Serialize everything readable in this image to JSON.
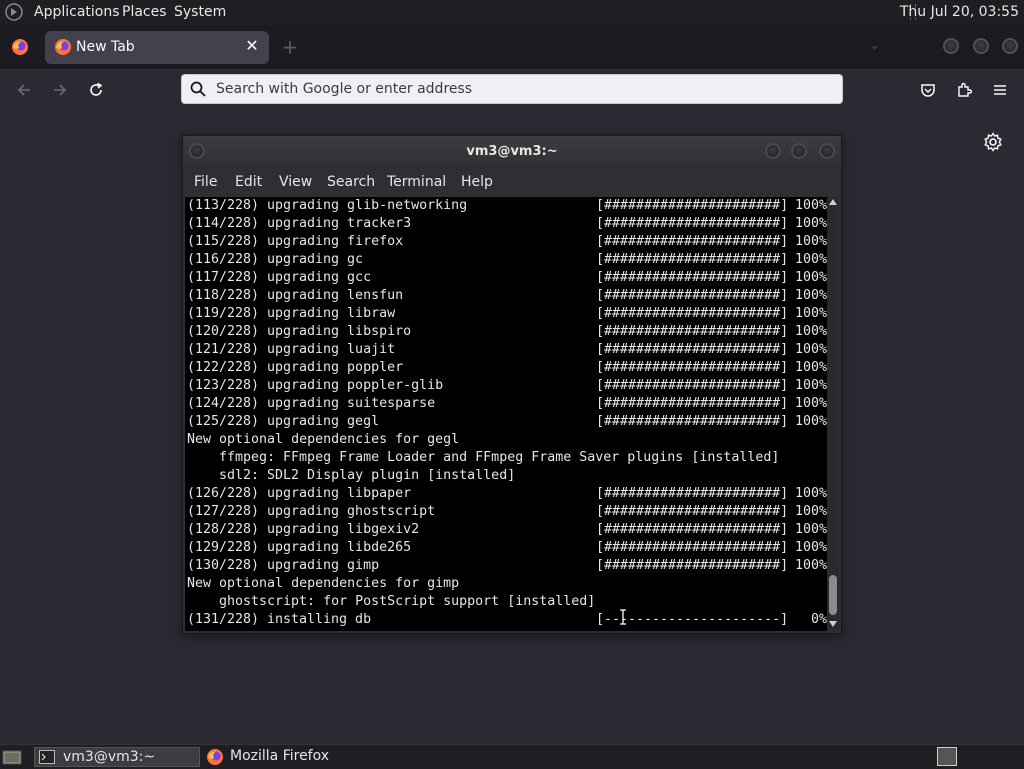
{
  "top_panel": {
    "menus": [
      "Applications",
      "Places",
      "System"
    ],
    "clock": "Thu Jul 20, 03:55"
  },
  "browser": {
    "tab_title": "New Tab",
    "url_placeholder": "Search with Google or enter address"
  },
  "terminal": {
    "title": "vm3@vm3:~",
    "menu": [
      "File",
      "Edit",
      "View",
      "Search",
      "Terminal",
      "Help"
    ],
    "lines": [
      {
        "kind": "progress",
        "num": "(113/228)",
        "text": "upgrading glib-networking",
        "bar": "[######################]",
        "pct": "100%"
      },
      {
        "kind": "progress",
        "num": "(114/228)",
        "text": "upgrading tracker3",
        "bar": "[######################]",
        "pct": "100%"
      },
      {
        "kind": "progress",
        "num": "(115/228)",
        "text": "upgrading firefox",
        "bar": "[######################]",
        "pct": "100%"
      },
      {
        "kind": "progress",
        "num": "(116/228)",
        "text": "upgrading gc",
        "bar": "[######################]",
        "pct": "100%"
      },
      {
        "kind": "progress",
        "num": "(117/228)",
        "text": "upgrading gcc",
        "bar": "[######################]",
        "pct": "100%"
      },
      {
        "kind": "progress",
        "num": "(118/228)",
        "text": "upgrading lensfun",
        "bar": "[######################]",
        "pct": "100%"
      },
      {
        "kind": "progress",
        "num": "(119/228)",
        "text": "upgrading libraw",
        "bar": "[######################]",
        "pct": "100%"
      },
      {
        "kind": "progress",
        "num": "(120/228)",
        "text": "upgrading libspiro",
        "bar": "[######################]",
        "pct": "100%"
      },
      {
        "kind": "progress",
        "num": "(121/228)",
        "text": "upgrading luajit",
        "bar": "[######################]",
        "pct": "100%"
      },
      {
        "kind": "progress",
        "num": "(122/228)",
        "text": "upgrading poppler",
        "bar": "[######################]",
        "pct": "100%"
      },
      {
        "kind": "progress",
        "num": "(123/228)",
        "text": "upgrading poppler-glib",
        "bar": "[######################]",
        "pct": "100%"
      },
      {
        "kind": "progress",
        "num": "(124/228)",
        "text": "upgrading suitesparse",
        "bar": "[######################]",
        "pct": "100%"
      },
      {
        "kind": "progress",
        "num": "(125/228)",
        "text": "upgrading gegl",
        "bar": "[######################]",
        "pct": "100%"
      },
      {
        "kind": "plain",
        "text": "New optional dependencies for gegl"
      },
      {
        "kind": "sub",
        "text": "ffmpeg: FFmpeg Frame Loader and FFmpeg Frame Saver plugins [installed]"
      },
      {
        "kind": "sub",
        "text": "sdl2: SDL2 Display plugin [installed]"
      },
      {
        "kind": "progress",
        "num": "(126/228)",
        "text": "upgrading libpaper",
        "bar": "[######################]",
        "pct": "100%"
      },
      {
        "kind": "progress",
        "num": "(127/228)",
        "text": "upgrading ghostscript",
        "bar": "[######################]",
        "pct": "100%"
      },
      {
        "kind": "progress",
        "num": "(128/228)",
        "text": "upgrading libgexiv2",
        "bar": "[######################]",
        "pct": "100%"
      },
      {
        "kind": "progress",
        "num": "(129/228)",
        "text": "upgrading libde265",
        "bar": "[######################]",
        "pct": "100%"
      },
      {
        "kind": "progress",
        "num": "(130/228)",
        "text": "upgrading gimp",
        "bar": "[######################]",
        "pct": "100%"
      },
      {
        "kind": "plain",
        "text": "New optional dependencies for gimp"
      },
      {
        "kind": "sub",
        "text": "ghostscript: for PostScript support [installed]"
      },
      {
        "kind": "progress",
        "num": "(131/228)",
        "text": "installing db",
        "bar": "[----------------------]",
        "pct": "0%"
      }
    ]
  },
  "taskbar": {
    "tasks": [
      "vm3@vm3:~",
      "Mozilla Firefox"
    ]
  },
  "colors": {
    "panel_bg": "#1f1f23",
    "browser_bg": "#2b2a33",
    "urlbar_bg": "#f0f0f4",
    "terminal_bg": "#000000"
  }
}
